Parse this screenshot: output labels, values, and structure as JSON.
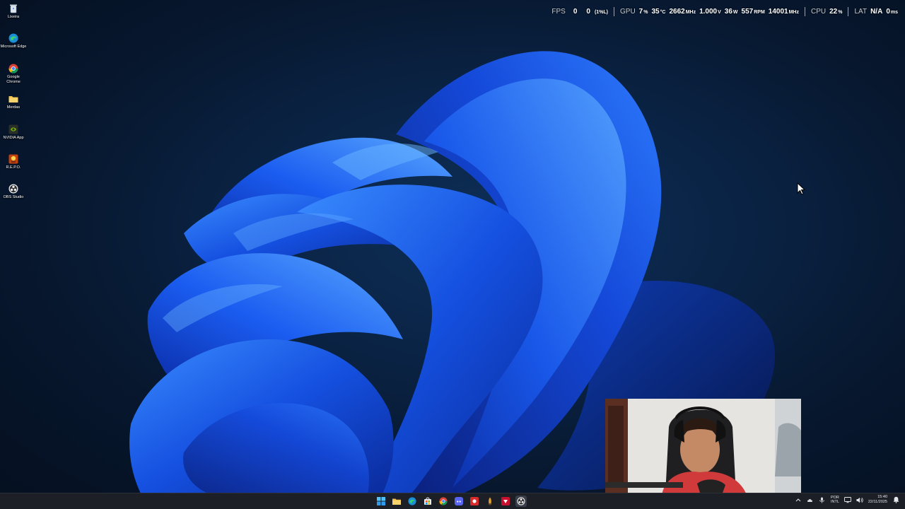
{
  "desktop": {
    "icons": [
      {
        "label": "Lixeira",
        "icon": "recycle-bin-icon"
      },
      {
        "label": "Microsoft Edge",
        "icon": "edge-icon"
      },
      {
        "label": "Google Chrome",
        "icon": "chrome-icon"
      },
      {
        "label": "Merdas",
        "icon": "folder-icon"
      },
      {
        "label": "NVIDIA App",
        "icon": "nvidia-icon"
      },
      {
        "label": "R.E.P.O.",
        "icon": "repo-game-icon"
      },
      {
        "label": "OBS Studio",
        "icon": "obs-icon"
      }
    ]
  },
  "overlay": {
    "fps": {
      "label": "FPS",
      "value": "0",
      "low": "0",
      "low_unit": "(1%L)"
    },
    "gpu": {
      "label": "GPU",
      "usage": "7",
      "usage_unit": "%",
      "temp": "35",
      "temp_unit": "°C",
      "clock": "2662",
      "clock_unit": "MHz",
      "voltage": "1.000",
      "voltage_unit": "V",
      "power": "36",
      "power_unit": "W",
      "fan": "557",
      "fan_unit": "RPM",
      "mem_clock": "14001",
      "mem_clock_unit": "MHz"
    },
    "cpu": {
      "label": "CPU",
      "usage": "22",
      "usage_unit": "%"
    },
    "lat": {
      "label": "LAT",
      "value": "N/A",
      "ms": "0",
      "ms_unit": "ms"
    }
  },
  "taskbar": {
    "apps": [
      {
        "icon": "start-icon"
      },
      {
        "icon": "file-explorer-icon"
      },
      {
        "icon": "edge-icon"
      },
      {
        "icon": "store-icon"
      },
      {
        "icon": "chrome-icon"
      },
      {
        "icon": "discord-icon"
      },
      {
        "icon": "record-app-icon"
      },
      {
        "icon": "pen-app-icon"
      },
      {
        "icon": "red-app-icon"
      },
      {
        "icon": "obs-icon"
      }
    ],
    "tray": {
      "language_line1": "POR",
      "language_line2": "INTL",
      "time": "15:40",
      "date": "22/11/2025"
    }
  },
  "colors": {
    "accent": "#1e63f0",
    "taskbar": "#1c1f26",
    "background": "#0a2344"
  }
}
